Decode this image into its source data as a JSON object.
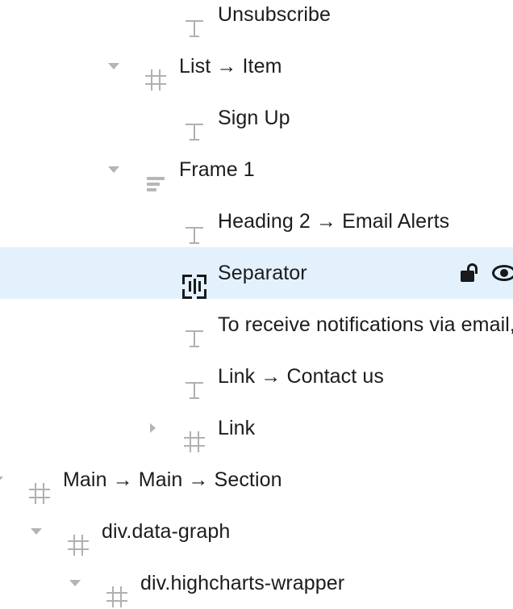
{
  "panel": {
    "name": "layers-tree",
    "selection_color": "#e3f1fc",
    "rows": [
      {
        "label": "Unsubscribe",
        "icon": "text-icon",
        "twisty": "none",
        "indent": 0,
        "selected": false
      },
      {
        "label": "List → Item",
        "icon": "element-hash-icon",
        "twisty": "expanded",
        "indent": 1,
        "selected": false
      },
      {
        "label": "Sign Up",
        "icon": "text-icon",
        "twisty": "none",
        "indent": 0,
        "selected": false
      },
      {
        "label": "Frame 1",
        "icon": "frame-icon",
        "twisty": "expanded",
        "indent": 1,
        "selected": false
      },
      {
        "label": "Heading 2 → Email Alerts",
        "icon": "text-icon",
        "twisty": "none",
        "indent": 0,
        "selected": false
      },
      {
        "label": "Separator",
        "icon": "separator-icon",
        "twisty": "none",
        "indent": 0,
        "selected": true,
        "actions": [
          "unlock-icon",
          "eye-icon"
        ]
      },
      {
        "label": "To receive notifications via email, ..",
        "icon": "text-icon",
        "twisty": "none",
        "indent": 0,
        "selected": false
      },
      {
        "label": "Link → Contact us",
        "icon": "text-icon",
        "twisty": "none",
        "indent": 0,
        "selected": false
      },
      {
        "label": "Link",
        "icon": "element-hash-icon",
        "twisty": "collapsed",
        "indent": 2,
        "selected": false
      },
      {
        "label": "Main → Main → Section",
        "icon": "element-hash-icon",
        "twisty": "expanded",
        "indent": 3,
        "selected": false
      },
      {
        "label": "div.data-graph",
        "icon": "element-hash-icon",
        "twisty": "expanded",
        "indent": 4,
        "selected": false
      },
      {
        "label": "div.highcharts-wrapper",
        "icon": "element-hash-icon",
        "twisty": "expanded",
        "indent": 5,
        "selected": false
      }
    ]
  }
}
